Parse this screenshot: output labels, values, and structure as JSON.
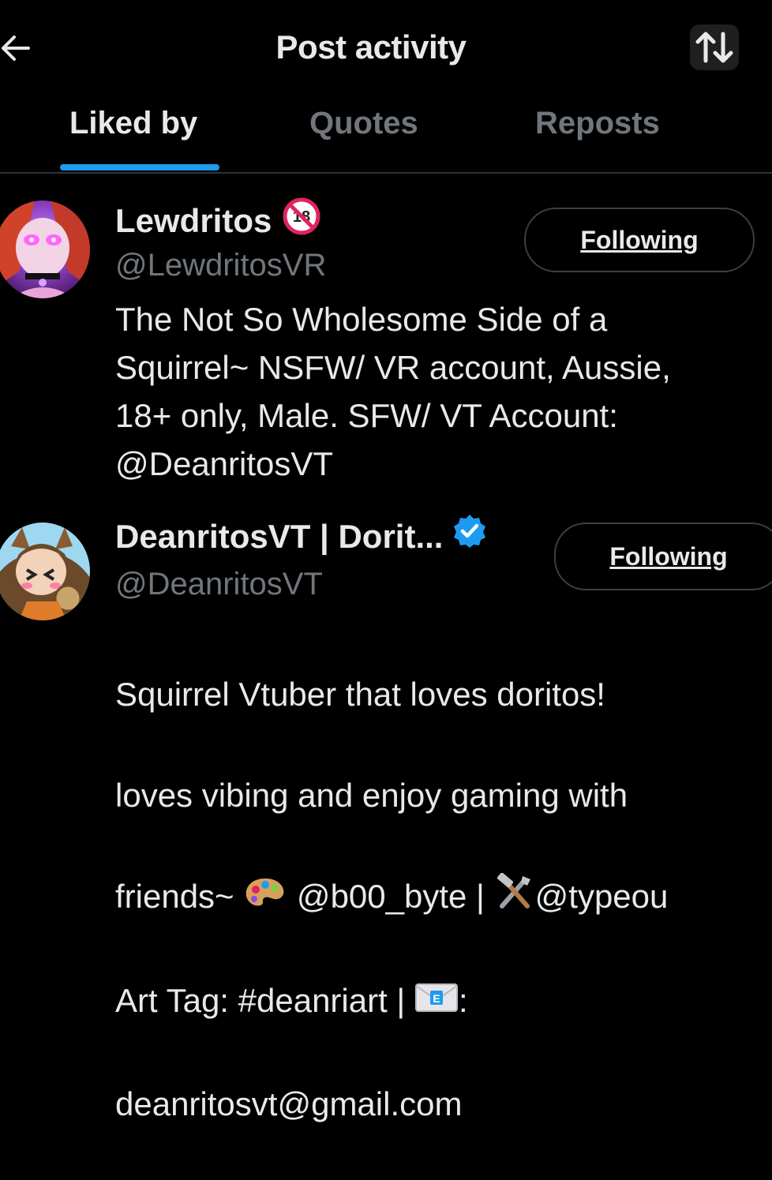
{
  "header": {
    "title": "Post activity",
    "back_icon": "arrow-left-icon",
    "sort_icon": "sort-arrows-icon"
  },
  "tabs": [
    {
      "label": "Liked by",
      "active": true
    },
    {
      "label": "Quotes",
      "active": false
    },
    {
      "label": "Reposts",
      "active": false
    }
  ],
  "colors": {
    "background": "#000000",
    "accent": "#1d9bf0",
    "text_primary": "#e7e9ea",
    "text_secondary": "#71767b",
    "verified": "#1d9bf0",
    "nsfw_badge": "#e0245e"
  },
  "users": [
    {
      "name": "Lewdritos",
      "badge_icon": "no-under-18-icon",
      "handle": "@LewdritosVR",
      "bio": "The Not So Wholesome Side of a\nSquirrel~ NSFW/ VR account, Aussie,\n18+ only, Male. SFW/ VT Account:\n@DeanritosVT",
      "follow_label": "Following"
    },
    {
      "name": "DeanritosVT | Dorit...",
      "badge_icon": "verified-checkmark-icon",
      "handle": "@DeanritosVT",
      "bio_lines": [
        "Squirrel Vtuber that loves doritos!",
        "loves vibing and enjoy gaming with",
        "friends~ ",
        " @b00_byte | ",
        "@typeou",
        "Art Tag: #deanriart | ",
        ":",
        "deanritosvt@gmail.com"
      ],
      "bio_icons": [
        "artist-palette-icon",
        "hammer-and-wrench-icon",
        "envelope-icon"
      ],
      "follow_label": "Following"
    }
  ]
}
